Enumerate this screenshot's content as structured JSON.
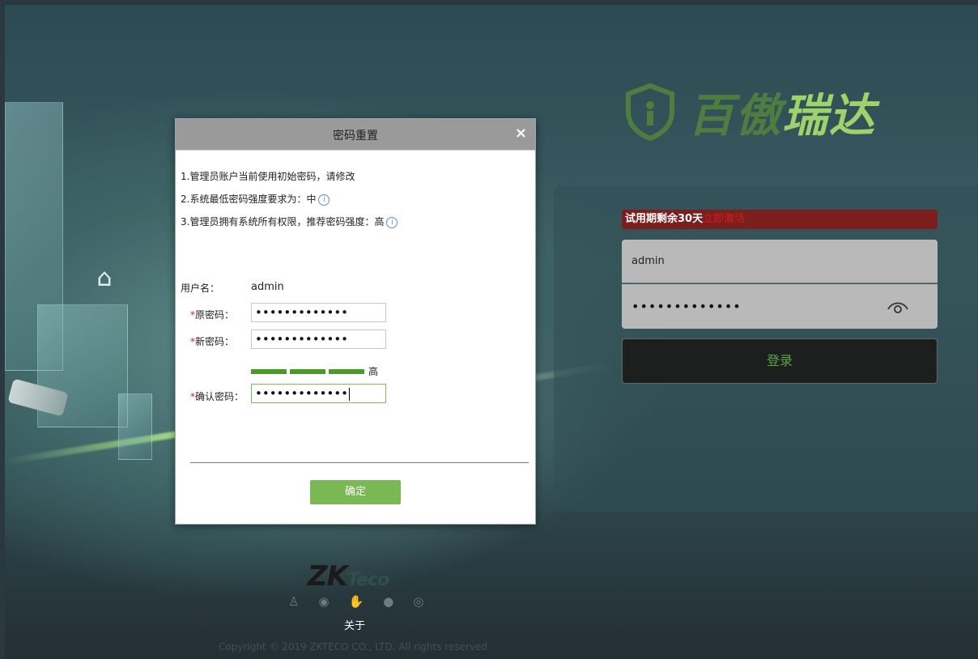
{
  "brand": {
    "part1": "百傲",
    "part2": "瑞达"
  },
  "login": {
    "trial_text": "试用期剩余30天",
    "trial_action": "立即激活",
    "username_value": "admin",
    "password_value": "•••••••••••••",
    "login_button": "登录"
  },
  "dialog": {
    "title": "密码重置",
    "close": "×",
    "notes": [
      "1.管理员账户当前使用初始密码，请修改",
      "2.系统最低密码强度要求为：中",
      "3.管理员拥有系统所有权限，推荐密码强度：高"
    ],
    "username_label": "用户名：",
    "username_value": "admin",
    "required_mark": "*",
    "old_password_label": "原密码：",
    "old_password_value": "•••••••••••••",
    "new_password_label": "新密码：",
    "new_password_value": "•••••••••••••",
    "strength_level": "高",
    "confirm_password_label": "确认密码：",
    "confirm_password_value": "•••••••••••••",
    "confirm_button": "确定"
  },
  "footer": {
    "logo_zk": "ZK",
    "logo_teco": "Teco",
    "about": "关于",
    "copyright": "Copyright © 2019 ZKTECO CO., LTD. All rights reserved"
  },
  "icons": {
    "biometric": [
      "person-icon",
      "face-icon",
      "palm-icon",
      "fingerprint-icon",
      "iris-icon"
    ],
    "info": "info-icon",
    "eye": "eye-icon",
    "close": "close-icon"
  },
  "colors": {
    "accent_green": "#7ab854",
    "trial_red": "#7a1e1e",
    "brand_dark_green": "#4f7d3f",
    "brand_light_green": "#9ed26a"
  }
}
